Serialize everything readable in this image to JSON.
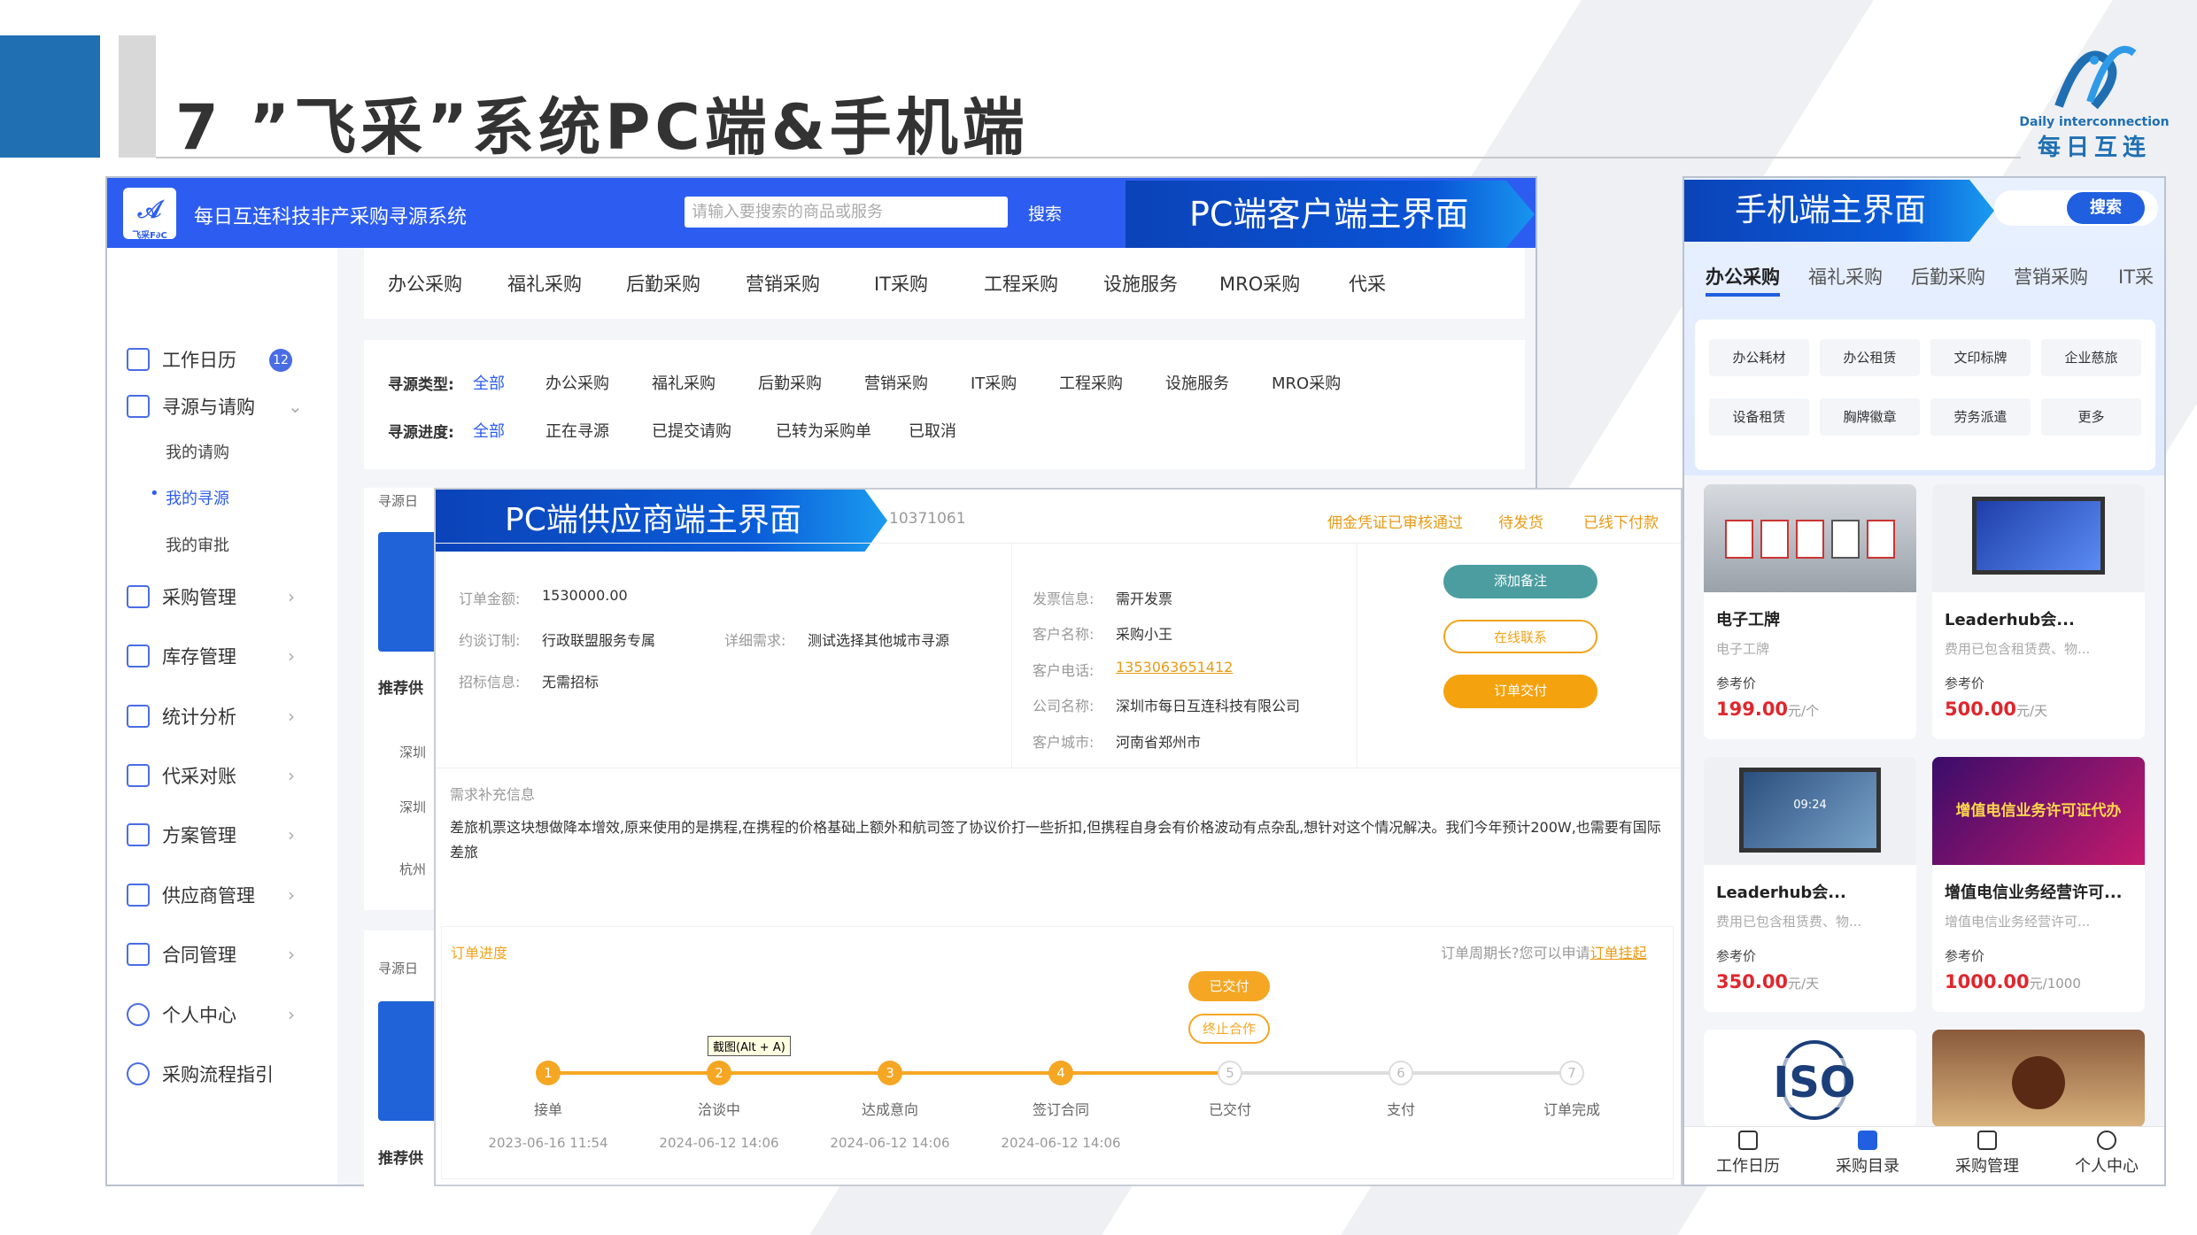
{
  "slide": {
    "title": "7 ”飞采”系统PC端&手机端",
    "logo_en": "Daily interconnection",
    "logo_cn": "每日互连"
  },
  "pc": {
    "app_name": "每日互连科技非产采购寻源系统",
    "logo_text": "飞采F∂C",
    "search_placeholder": "请输入要搜索的商品或服务",
    "search_button": "搜索",
    "ribbon": "PC端客户端主界面",
    "sidebar": {
      "items": [
        {
          "label": "工作日历",
          "badge": "12"
        },
        {
          "label": "寻源与请购"
        },
        {
          "label": "采购管理"
        },
        {
          "label": "库存管理"
        },
        {
          "label": "统计分析"
        },
        {
          "label": "代采对账"
        },
        {
          "label": "方案管理"
        },
        {
          "label": "供应商管理"
        },
        {
          "label": "合同管理"
        },
        {
          "label": "个人中心"
        },
        {
          "label": "采购流程指引"
        }
      ],
      "sub_items": [
        "我的请购",
        "我的寻源",
        "我的审批"
      ],
      "active_sub": "我的寻源"
    },
    "tabs": [
      "办公采购",
      "福礼采购",
      "后勤采购",
      "营销采购",
      "IT采购",
      "工程采购",
      "设施服务",
      "MRO采购",
      "代采"
    ],
    "filters": {
      "type_label": "寻源类型:",
      "type_options": [
        "全部",
        "办公采购",
        "福礼采购",
        "后勤采购",
        "营销采购",
        "IT采购",
        "工程采购",
        "设施服务",
        "MRO采购"
      ],
      "progress_label": "寻源进度:",
      "progress_options": [
        "全部",
        "正在寻源",
        "已提交请购",
        "已转为采购单",
        "已取消"
      ]
    },
    "stubs": {
      "source_label": "寻源日",
      "recommend_label": "推荐供",
      "row1": "深圳",
      "row2": "深圳",
      "row3": "杭州"
    }
  },
  "supplier": {
    "ribbon": "PC端供应商端主界面",
    "order_no": "10371061",
    "statuses": [
      "佣金凭证已审核通过",
      "待发货",
      "已线下付款"
    ],
    "fields_left": [
      {
        "k": "订单金额:",
        "v": "1530000.00"
      },
      {
        "k": "约谈订制:",
        "v": "行政联盟服务专属"
      },
      {
        "k": "招标信息:",
        "v": "无需招标"
      }
    ],
    "detail_k": "详细需求:",
    "detail_v": "测试选择其他城市寻源",
    "fields_right": [
      {
        "k": "发票信息:",
        "v": "需开发票"
      },
      {
        "k": "客户名称:",
        "v": "采购小王"
      },
      {
        "k": "客户电话:",
        "v": "1353063651412"
      },
      {
        "k": "公司名称:",
        "v": "深圳市每日互连科技有限公司"
      },
      {
        "k": "客户城市:",
        "v": "河南省郑州市"
      }
    ],
    "buttons": {
      "note": "添加备注",
      "contact": "在线联系",
      "pay": "订单交付"
    },
    "requirement_title": "需求补充信息",
    "requirement_text": "差旅机票这块想做降本增效,原来使用的是携程,在携程的价格基础上额外和航司签了协议价打一些折扣,但携程自身会有价格波动有点杂乱,想针对这个情况解决。我们今年预计200W,也需要有国际差旅",
    "progress": {
      "title": "订单进度",
      "note_prefix": "订单周期长?您可以申请",
      "note_link": "订单挂起",
      "paid_button": "已交付",
      "stop_button": "终止合作",
      "tooltip": "截图(Alt + A)",
      "steps": [
        {
          "n": "1",
          "label": "接单",
          "time": "2023-06-16 11:54",
          "done": true
        },
        {
          "n": "2",
          "label": "洽谈中",
          "time": "2024-06-12 14:06",
          "done": true
        },
        {
          "n": "3",
          "label": "达成意向",
          "time": "2024-06-12 14:06",
          "done": true
        },
        {
          "n": "4",
          "label": "签订合同",
          "time": "2024-06-12 14:06",
          "done": true
        },
        {
          "n": "5",
          "label": "已交付",
          "time": "",
          "done": false
        },
        {
          "n": "6",
          "label": "支付",
          "time": "",
          "done": false
        },
        {
          "n": "7",
          "label": "订单完成",
          "time": "",
          "done": false
        }
      ]
    }
  },
  "mobile": {
    "ribbon": "手机端主界面",
    "search_button": "搜索",
    "tabs": [
      "办公采购",
      "福礼采购",
      "后勤采购",
      "营销采购",
      "IT采"
    ],
    "categories": [
      "办公耗材",
      "办公租赁",
      "文印标牌",
      "企业慈旅",
      "设备租赁",
      "胸牌徽章",
      "劳务派遣",
      "更多"
    ],
    "products": [
      {
        "name": "电子工牌",
        "desc": "电子工牌",
        "ref": "参考价",
        "price": "199.00",
        "unit": "元/个"
      },
      {
        "name": "Leaderhub会...",
        "desc": "费用已包含租赁费、物...",
        "ref": "参考价",
        "price": "500.00",
        "unit": "元/天"
      },
      {
        "name": "Leaderhub会...",
        "desc": "费用已包含租赁费、物...",
        "ref": "参考价",
        "price": "350.00",
        "unit": "元/天"
      },
      {
        "name": "增值电信业务经营许可...",
        "desc": "增值电信业务经营许可...",
        "ref": "参考价",
        "price": "1000.00",
        "unit": "元/1000"
      }
    ],
    "banner_text": "增值电信业务许可证代办",
    "screen_time": "09:24",
    "iso_text": "ISO",
    "nav": [
      "工作日历",
      "采购目录",
      "采购管理",
      "个人中心"
    ],
    "colors": {
      "accent": "#1f5fe0",
      "price": "#e0262d"
    }
  }
}
